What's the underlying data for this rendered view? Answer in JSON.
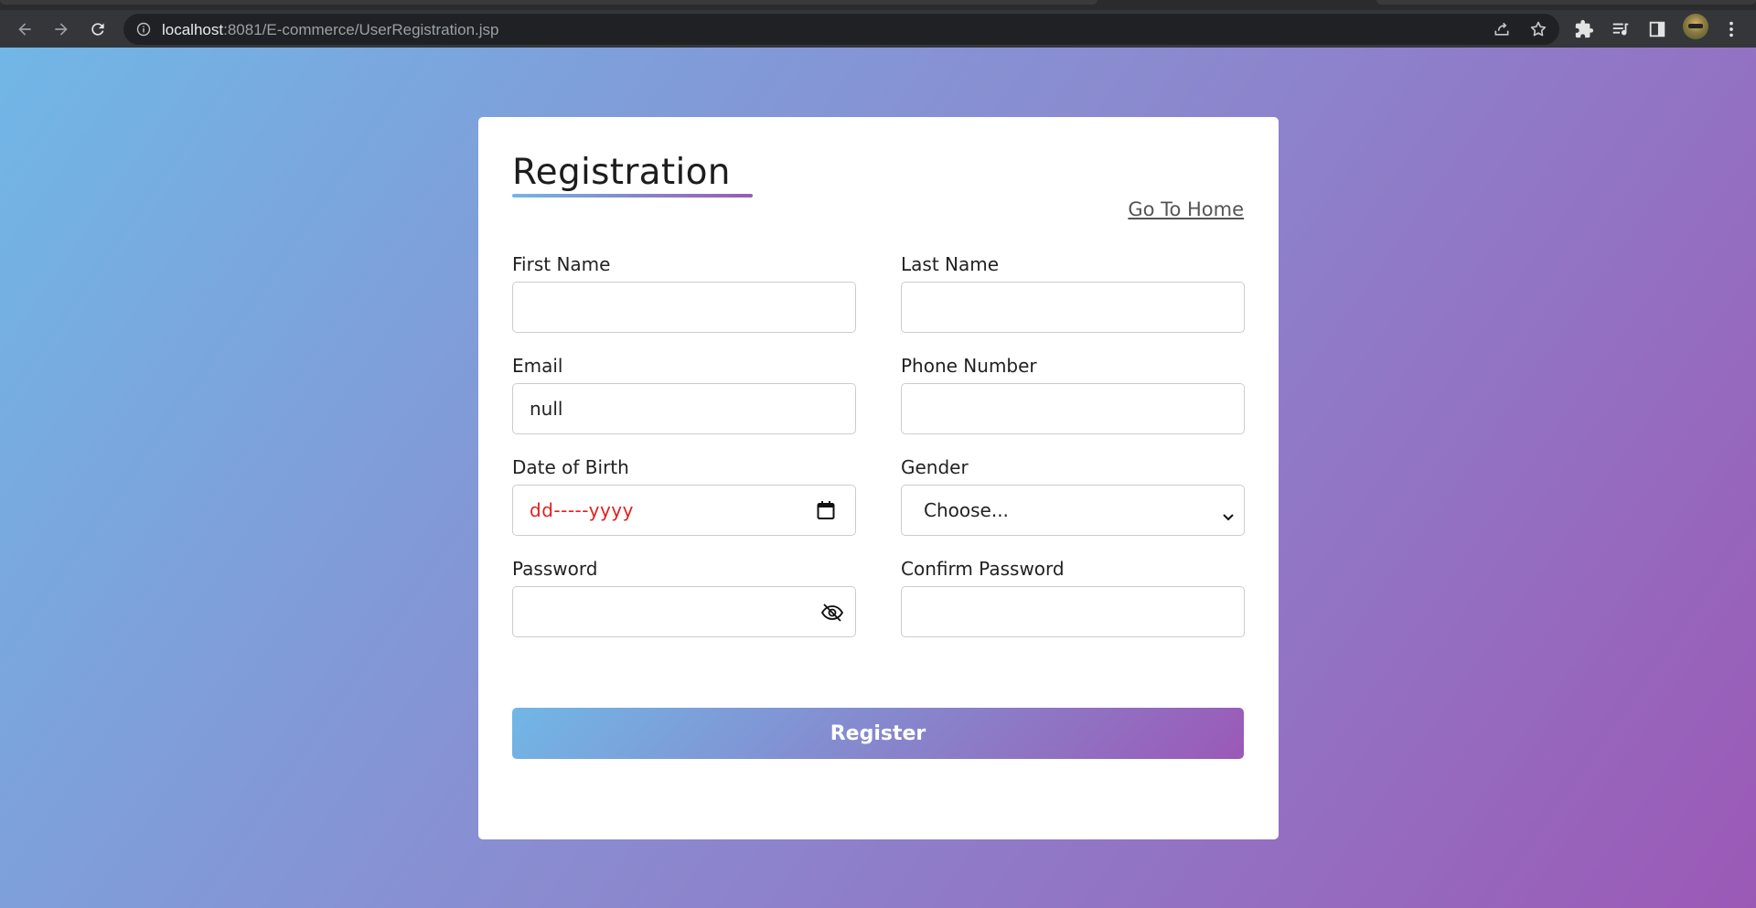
{
  "browser": {
    "url_host": "localhost",
    "url_path": ":8081/E-commerce/UserRegistration.jsp",
    "icons": [
      "back-icon",
      "forward-icon",
      "reload-icon",
      "info-icon",
      "share-icon",
      "star-icon",
      "extensions-icon",
      "media-icon",
      "side-panel-icon",
      "profile-avatar",
      "menu-icon"
    ]
  },
  "form": {
    "title": "Registration",
    "home_link": "Go To Home",
    "first_name_label": "First Name",
    "first_name_value": "",
    "last_name_label": "Last Name",
    "last_name_value": "",
    "email_label": "Email",
    "email_value": "null",
    "phone_label": "Phone Number",
    "phone_value": "",
    "dob_label": "Date of Birth",
    "dob_value": "dd-----yyyy",
    "gender_label": "Gender",
    "gender_value": "Choose...",
    "password_label": "Password",
    "password_value": "",
    "confirm_password_label": "Confirm Password",
    "confirm_password_value": "",
    "register_label": "Register"
  },
  "colors": {
    "gradient_start": "#71b7e6",
    "gradient_end": "#9b59b6",
    "date_placeholder": "#e02020"
  }
}
